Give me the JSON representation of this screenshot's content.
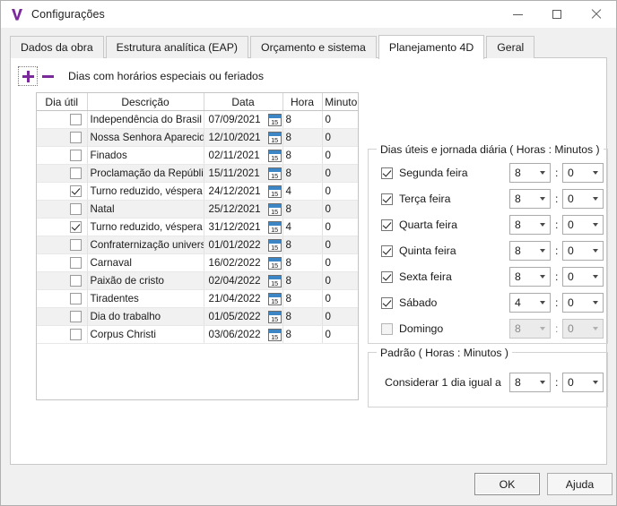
{
  "window": {
    "title": "Configurações",
    "icon": "app-logo-v-icon",
    "controls": {
      "minimize": "minimize-icon",
      "maximize": "maximize-icon",
      "close": "close-icon"
    }
  },
  "tabs": [
    {
      "label": "Dados da obra",
      "active": false
    },
    {
      "label": "Estrutura analítica (EAP)",
      "active": false
    },
    {
      "label": "Orçamento e sistema",
      "active": false
    },
    {
      "label": "Planejamento 4D",
      "active": true
    },
    {
      "label": "Geral",
      "active": false
    }
  ],
  "toolbar": {
    "add_label": "+",
    "remove_label": "-",
    "caption": "Dias com horários especiais ou feriados"
  },
  "grid": {
    "columns": [
      "Dia útil",
      "Descrição",
      "Data",
      "Hora",
      "Minuto"
    ],
    "rows": [
      {
        "dia_util": false,
        "descricao": "Independência do Brasil",
        "data": "07/09/2021",
        "hora": "8",
        "minuto": "0"
      },
      {
        "dia_util": false,
        "descricao": "Nossa Senhora Aparecida",
        "data": "12/10/2021",
        "hora": "8",
        "minuto": "0"
      },
      {
        "dia_util": false,
        "descricao": "Finados",
        "data": "02/11/2021",
        "hora": "8",
        "minuto": "0"
      },
      {
        "dia_util": false,
        "descricao": "Proclamação da República",
        "data": "15/11/2021",
        "hora": "8",
        "minuto": "0"
      },
      {
        "dia_util": true,
        "descricao": "Turno reduzido, véspera N",
        "data": "24/12/2021",
        "hora": "4",
        "minuto": "0"
      },
      {
        "dia_util": false,
        "descricao": "Natal",
        "data": "25/12/2021",
        "hora": "8",
        "minuto": "0"
      },
      {
        "dia_util": true,
        "descricao": "Turno reduzido, véspera a",
        "data": "31/12/2021",
        "hora": "4",
        "minuto": "0"
      },
      {
        "dia_util": false,
        "descricao": "Confraternização universa",
        "data": "01/01/2022",
        "hora": "8",
        "minuto": "0"
      },
      {
        "dia_util": false,
        "descricao": "Carnaval",
        "data": "16/02/2022",
        "hora": "8",
        "minuto": "0"
      },
      {
        "dia_util": false,
        "descricao": "Paixão de cristo",
        "data": "02/04/2022",
        "hora": "8",
        "minuto": "0"
      },
      {
        "dia_util": false,
        "descricao": "Tiradentes",
        "data": "21/04/2022",
        "hora": "8",
        "minuto": "0"
      },
      {
        "dia_util": false,
        "descricao": "Dia do trabalho",
        "data": "01/05/2022",
        "hora": "8",
        "minuto": "0"
      },
      {
        "dia_util": false,
        "descricao": "Corpus Christi",
        "data": "03/06/2022",
        "hora": "8",
        "minuto": "0"
      }
    ],
    "date_picker_icon_label": "15"
  },
  "weekdays_group": {
    "title": "Dias úteis e jornada diária ( Horas : Minutos )",
    "separator": ":",
    "days": [
      {
        "label": "Segunda feira",
        "checked": true,
        "hours": "8",
        "minutes": "0",
        "enabled": true
      },
      {
        "label": "Terça feira",
        "checked": true,
        "hours": "8",
        "minutes": "0",
        "enabled": true
      },
      {
        "label": "Quarta feira",
        "checked": true,
        "hours": "8",
        "minutes": "0",
        "enabled": true
      },
      {
        "label": "Quinta feira",
        "checked": true,
        "hours": "8",
        "minutes": "0",
        "enabled": true
      },
      {
        "label": "Sexta feira",
        "checked": true,
        "hours": "8",
        "minutes": "0",
        "enabled": true
      },
      {
        "label": "Sábado",
        "checked": true,
        "hours": "4",
        "minutes": "0",
        "enabled": true
      },
      {
        "label": "Domingo",
        "checked": false,
        "hours": "8",
        "minutes": "0",
        "enabled": false
      }
    ]
  },
  "default_group": {
    "title": "Padrão ( Horas : Minutos )",
    "label": "Considerar 1 dia igual a",
    "separator": ":",
    "hours": "8",
    "minutes": "0"
  },
  "footer": {
    "ok_label": "OK",
    "help_label": "Ajuda"
  },
  "colors": {
    "accent_purple": "#7b2a9b",
    "calendar_blue": "#3d86c6",
    "row_alt": "#f2f1f2",
    "window_bg": "#f0f0f0"
  }
}
